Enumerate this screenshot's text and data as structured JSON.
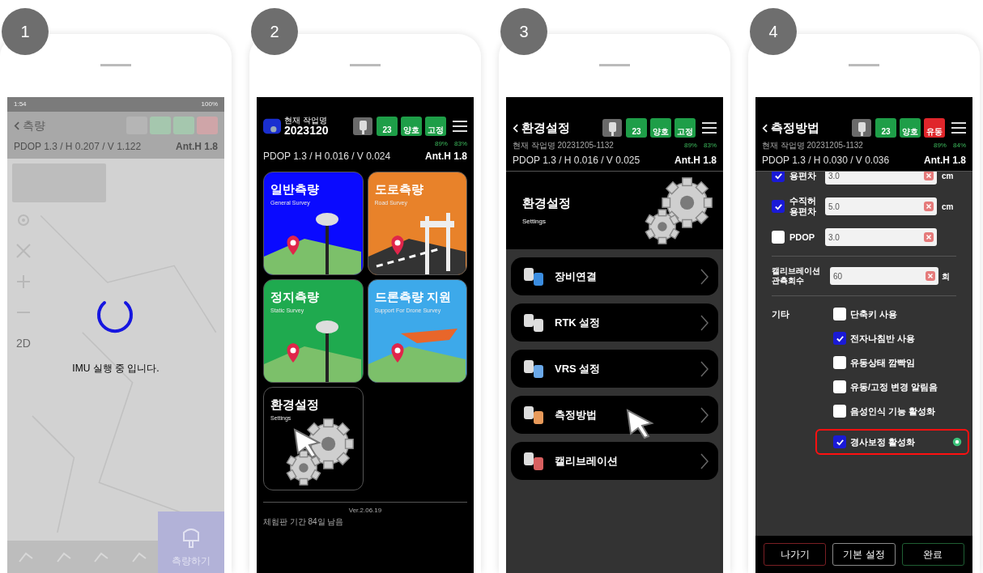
{
  "steps": [
    {
      "number": "1",
      "kind": "loading",
      "time": "1:54",
      "battery": "100%",
      "title": "측량",
      "precision": "PDOP 1.3 / H 0.207 / V 1.122",
      "antenna": "Ant.H 1.8",
      "map_mode": "2D",
      "message": "IMU 실행 중 입니다.",
      "action": "측량하기"
    },
    {
      "number": "2",
      "kind": "home",
      "job_label": "현재 작업명",
      "job_name": "2023120",
      "badges": [
        {
          "value": "23",
          "color": "#1e9e48"
        },
        {
          "value": "양호",
          "color": "#1e9e48"
        },
        {
          "value": "고정",
          "color": "#1e9e48"
        }
      ],
      "signal": "89%",
      "power": "83%",
      "precision": "PDOP 1.3 / H 0.016 / V 0.024",
      "antenna": "Ant.H 1.8",
      "tiles": [
        {
          "kind": "general",
          "title": "일반측량",
          "subtitle": "General Survey",
          "color": "#0a0aff",
          "selected": false
        },
        {
          "kind": "road",
          "title": "도로측량",
          "subtitle": "Road Survey",
          "color": "#e8822a",
          "selected": false
        },
        {
          "kind": "static",
          "title": "정지측량",
          "subtitle": "Static Survey",
          "color": "#1faa4f",
          "selected": false
        },
        {
          "kind": "drone",
          "title": "드론측량 지원",
          "subtitle": "Support For Drone Survey",
          "color": "#3da9ea",
          "selected": false
        },
        {
          "kind": "settings",
          "title": "환경설정",
          "subtitle": "Settings",
          "color": "#000000",
          "selected": true
        }
      ],
      "version": "Ver.2.06.19",
      "trial": "체험판 기간 84일 남음"
    },
    {
      "number": "3",
      "kind": "settings",
      "title": "환경설정",
      "badges": [
        {
          "value": "23",
          "color": "#1e9e48"
        },
        {
          "value": "양호",
          "color": "#1e9e48"
        },
        {
          "value": "고정",
          "color": "#1e9e48"
        }
      ],
      "job": "현재 작업명 20231205-1132",
      "signal": "89%",
      "power": "83%",
      "precision": "PDOP 1.3 / H 0.016 / V 0.025",
      "antenna": "Ant.H 1.8",
      "banner_title": "환경설정",
      "banner_subtitle": "Settings",
      "menu": [
        {
          "kind": "device",
          "label": "장비연결",
          "selected": false
        },
        {
          "kind": "rtk",
          "label": "RTK 설정",
          "selected": false
        },
        {
          "kind": "vrs",
          "label": "VRS 설정",
          "selected": false
        },
        {
          "kind": "method",
          "label": "측정방법",
          "selected": true
        },
        {
          "kind": "calibration",
          "label": "캘리브레이션",
          "selected": false
        }
      ]
    },
    {
      "number": "4",
      "kind": "method",
      "title": "측정방법",
      "badges": [
        {
          "value": "23",
          "color": "#1e9e48"
        },
        {
          "value": "양호",
          "color": "#1e9e48"
        },
        {
          "value": "유동",
          "color": "#e0262b"
        }
      ],
      "job": "현재 작업명 20231205-1132",
      "signal": "89%",
      "power": "84%",
      "precision": "PDOP 1.3 / H 0.030 / V 0.036",
      "antenna": "Ant.H 1.8",
      "limits": [
        {
          "label": "용편차",
          "checked": true,
          "value": "3.0",
          "unit": "cm"
        },
        {
          "label": "수직허용편차",
          "checked": true,
          "value": "5.0",
          "unit": "cm"
        },
        {
          "label": "PDOP",
          "checked": false,
          "value": "3.0"
        }
      ],
      "calibration": {
        "label": "캘리브레이션 관측회수",
        "value": "60",
        "unit": "회"
      },
      "others_label": "기타",
      "options": [
        {
          "label": "단축키 사용",
          "checked": false,
          "highlighted": false
        },
        {
          "label": "전자나침반 사용",
          "checked": true,
          "highlighted": false
        },
        {
          "label": "유동상태 깜빡임",
          "checked": false,
          "highlighted": false
        },
        {
          "label": "유동/고정 변경 알림음",
          "checked": false,
          "highlighted": false
        },
        {
          "label": "음성인식 기능 활성화",
          "checked": false,
          "highlighted": false
        },
        {
          "label": "경사보정 활성화",
          "checked": true,
          "highlighted": true
        }
      ],
      "buttons": [
        {
          "label": "나가기",
          "color": "#7a1f24"
        },
        {
          "label": "기본 설정",
          "color": "#8a8a8a"
        },
        {
          "label": "완료",
          "color": "#1f5e33"
        }
      ]
    }
  ]
}
